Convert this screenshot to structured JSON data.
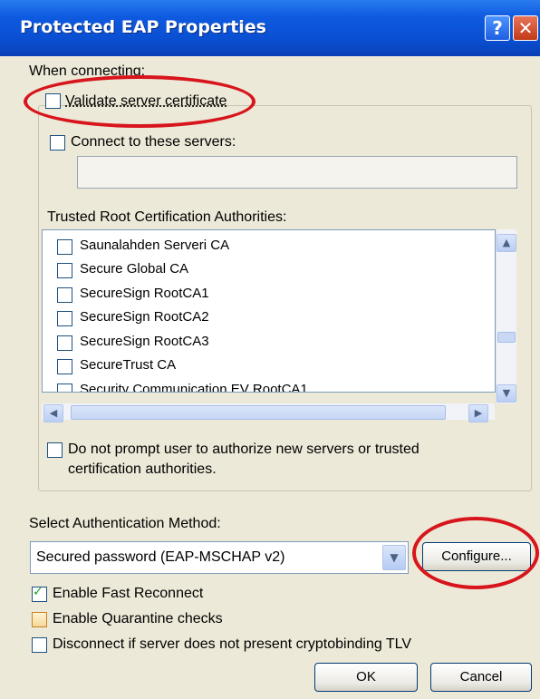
{
  "window": {
    "title": "Protected EAP Properties",
    "help_glyph": "?",
    "close_glyph": "✕"
  },
  "connecting": {
    "header": "When connecting:",
    "validate_cert": {
      "label": "Validate server certificate",
      "checked": false
    },
    "connect_servers": {
      "label": "Connect to these servers:",
      "checked": false
    },
    "servers_value": "",
    "trusted_root_label": "Trusted Root Certification Authorities:",
    "ca_list": [
      {
        "label": "Saunalahden Serveri CA",
        "checked": false
      },
      {
        "label": "Secure Global CA",
        "checked": false
      },
      {
        "label": "SecureSign RootCA1",
        "checked": false
      },
      {
        "label": "SecureSign RootCA2",
        "checked": false
      },
      {
        "label": "SecureSign RootCA3",
        "checked": false
      },
      {
        "label": "SecureTrust CA",
        "checked": false
      },
      {
        "label": "Security Communication EV RootCA1",
        "checked": false
      }
    ],
    "do_not_prompt": {
      "label_line1": "Do not prompt user to authorize new servers or trusted",
      "label_line2": "certification authorities.",
      "checked": false
    }
  },
  "auth": {
    "label": "Select Authentication Method:",
    "selected": "Secured password (EAP-MSCHAP v2)",
    "configure_label": "Configure..."
  },
  "options": {
    "fast_reconnect": {
      "label": "Enable Fast Reconnect",
      "checked": true
    },
    "quarantine": {
      "label": "Enable Quarantine checks",
      "checked": false
    },
    "cryptobinding": {
      "label": "Disconnect if server does not present cryptobinding TLV",
      "checked": false
    }
  },
  "buttons": {
    "ok": "OK",
    "cancel": "Cancel"
  },
  "colors": {
    "titlebar": "#0a4fd2",
    "dialog_bg": "#ece9d8",
    "annotation": "#d8141c"
  }
}
